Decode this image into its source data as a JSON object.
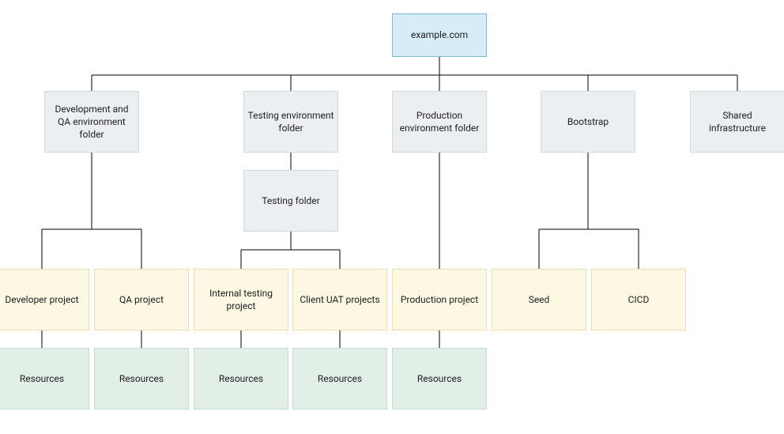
{
  "diagram": {
    "root": "example.com",
    "level1": {
      "dev_qa_folder": "Development and QA environment folder",
      "testing_folder": "Testing environment folder",
      "production_folder": "Production environment folder",
      "bootstrap": "Bootstrap",
      "shared_infra": "Shared infrastructure"
    },
    "level2": {
      "testing_subfolder": "Testing folder"
    },
    "projects": {
      "developer": "Developer project",
      "qa": "QA project",
      "internal_testing": "Internal testing project",
      "client_uat": "Client UAT projects",
      "production": "Production project",
      "seed": "Seed",
      "cicd": "CICD"
    },
    "resources": {
      "developer": "Resources",
      "qa": "Resources",
      "internal_testing": "Resources",
      "client_uat": "Resources",
      "production": "Resources"
    }
  }
}
